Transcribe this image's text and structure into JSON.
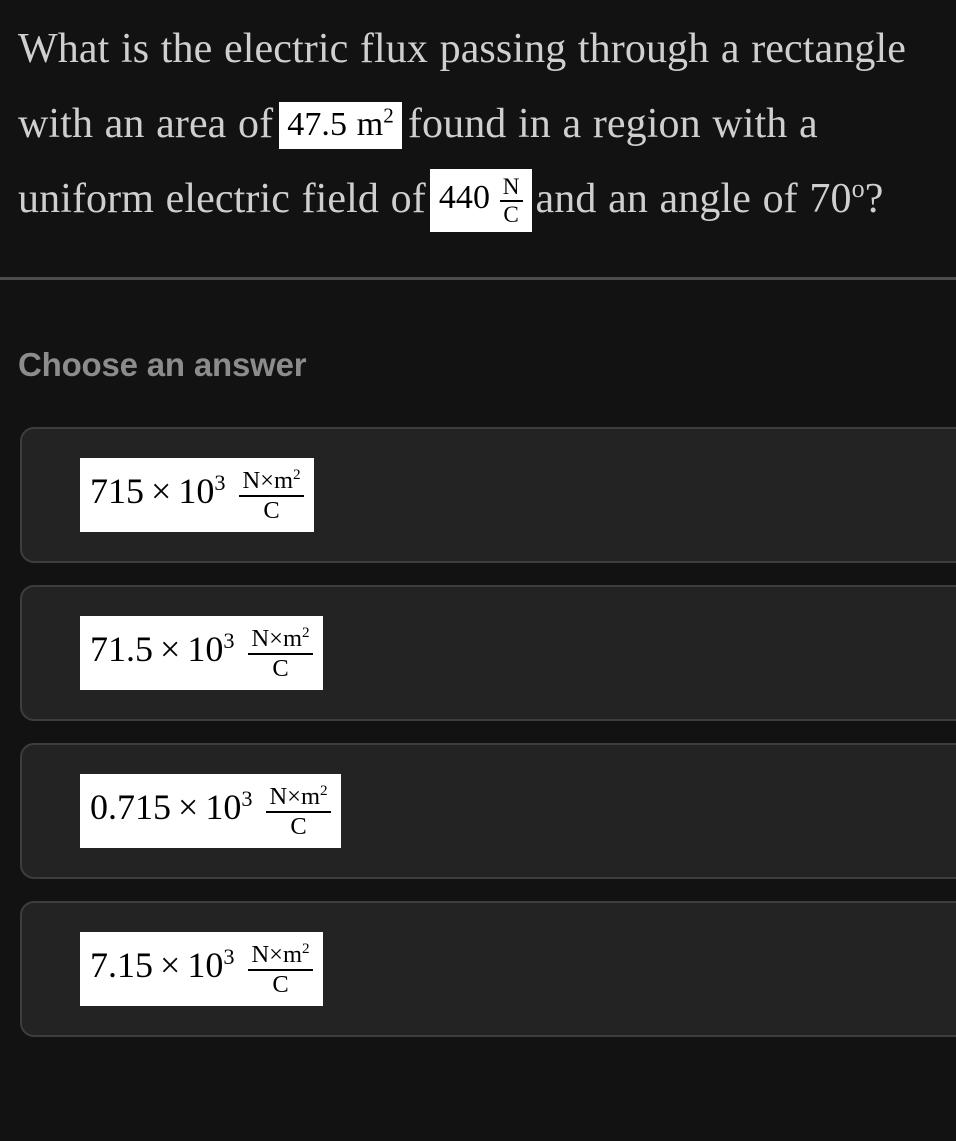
{
  "colors": {
    "page_background": "#121212",
    "card_background": "#232323",
    "card_border": "#3d3d3d",
    "question_text": "#cfcfcf",
    "section_label": "#8c8c8c",
    "divider": "#4c4c4c",
    "math_background": "#ffffff",
    "math_text": "#000000"
  },
  "question": {
    "part1": "What is the electric flux passing through a rectangle with an area of",
    "area_value": "47.5",
    "area_unit_base": "m",
    "area_unit_exponent": "2",
    "part2": "found in a region with a uniform electric field of",
    "field_value": "440",
    "field_unit_numerator": "N",
    "field_unit_denominator": "C",
    "part3": "and an angle of 70",
    "angle_degree_symbol": "o",
    "part4": "?"
  },
  "answers": {
    "section_label": "Choose an answer",
    "options": [
      {
        "coefficient": "715",
        "times": "×",
        "base": "10",
        "exponent": "3",
        "unit_numerator_first": "N",
        "unit_numerator_times": "×",
        "unit_numerator_second": "m",
        "unit_numerator_exponent": "2",
        "unit_denominator": "C"
      },
      {
        "coefficient": "71.5",
        "times": "×",
        "base": "10",
        "exponent": "3",
        "unit_numerator_first": "N",
        "unit_numerator_times": "×",
        "unit_numerator_second": "m",
        "unit_numerator_exponent": "2",
        "unit_denominator": "C"
      },
      {
        "coefficient": "0.715",
        "times": "×",
        "base": "10",
        "exponent": "3",
        "unit_numerator_first": "N",
        "unit_numerator_times": "×",
        "unit_numerator_second": "m",
        "unit_numerator_exponent": "2",
        "unit_denominator": "C"
      },
      {
        "coefficient": "7.15",
        "times": "×",
        "base": "10",
        "exponent": "3",
        "unit_numerator_first": "N",
        "unit_numerator_times": "×",
        "unit_numerator_second": "m",
        "unit_numerator_exponent": "2",
        "unit_denominator": "C"
      }
    ]
  }
}
